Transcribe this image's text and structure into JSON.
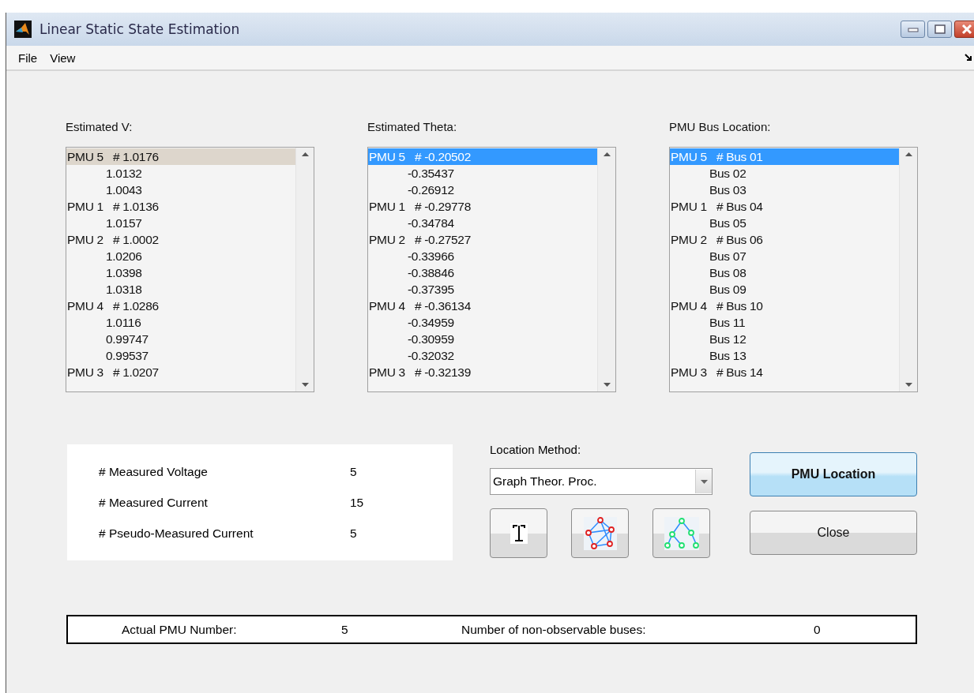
{
  "window": {
    "title": "Linear Static State Estimation"
  },
  "menu": [
    {
      "label": "File"
    },
    {
      "label": "View"
    }
  ],
  "lists": [
    {
      "label": "Estimated V:",
      "focused": false,
      "items": [
        {
          "kind": "head",
          "text": "PMU 5   # 1.0176",
          "selected": true
        },
        {
          "kind": "sub",
          "text": "1.0132",
          "selected": false
        },
        {
          "kind": "sub",
          "text": "1.0043",
          "selected": false
        },
        {
          "kind": "head",
          "text": "PMU 1   # 1.0136",
          "selected": false
        },
        {
          "kind": "sub",
          "text": "1.0157",
          "selected": false
        },
        {
          "kind": "head",
          "text": "PMU 2   # 1.0002",
          "selected": false
        },
        {
          "kind": "sub",
          "text": "1.0206",
          "selected": false
        },
        {
          "kind": "sub",
          "text": "1.0398",
          "selected": false
        },
        {
          "kind": "sub",
          "text": "1.0318",
          "selected": false
        },
        {
          "kind": "head",
          "text": "PMU 4   # 1.0286",
          "selected": false
        },
        {
          "kind": "sub",
          "text": "1.0116",
          "selected": false
        },
        {
          "kind": "sub",
          "text": "0.99747",
          "selected": false
        },
        {
          "kind": "sub",
          "text": "0.99537",
          "selected": false
        },
        {
          "kind": "head",
          "text": "PMU 3   # 1.0207",
          "selected": false
        }
      ]
    },
    {
      "label": "Estimated Theta:",
      "focused": true,
      "items": [
        {
          "kind": "head",
          "text": "PMU 5   # -0.20502",
          "selected": true
        },
        {
          "kind": "sub",
          "text": "-0.35437",
          "selected": false
        },
        {
          "kind": "sub",
          "text": "-0.26912",
          "selected": false
        },
        {
          "kind": "head",
          "text": "PMU 1   # -0.29778",
          "selected": false
        },
        {
          "kind": "sub",
          "text": "-0.34784",
          "selected": false
        },
        {
          "kind": "head",
          "text": "PMU 2   # -0.27527",
          "selected": false
        },
        {
          "kind": "sub",
          "text": "-0.33966",
          "selected": false
        },
        {
          "kind": "sub",
          "text": "-0.38846",
          "selected": false
        },
        {
          "kind": "sub",
          "text": "-0.37395",
          "selected": false
        },
        {
          "kind": "head",
          "text": "PMU 4   # -0.36134",
          "selected": false
        },
        {
          "kind": "sub",
          "text": "-0.34959",
          "selected": false
        },
        {
          "kind": "sub",
          "text": "-0.30959",
          "selected": false
        },
        {
          "kind": "sub",
          "text": "-0.32032",
          "selected": false
        },
        {
          "kind": "head",
          "text": "PMU 3   # -0.32139",
          "selected": false
        }
      ]
    },
    {
      "label": "PMU Bus Location:",
      "focused": true,
      "items": [
        {
          "kind": "head",
          "text": "PMU 5   # Bus 01",
          "selected": true
        },
        {
          "kind": "sub",
          "text": "Bus 02",
          "selected": false
        },
        {
          "kind": "sub",
          "text": "Bus 03",
          "selected": false
        },
        {
          "kind": "head",
          "text": "PMU 1   # Bus 04",
          "selected": false
        },
        {
          "kind": "sub",
          "text": "Bus 05",
          "selected": false
        },
        {
          "kind": "head",
          "text": "PMU 2   # Bus 06",
          "selected": false
        },
        {
          "kind": "sub",
          "text": "Bus 07",
          "selected": false
        },
        {
          "kind": "sub",
          "text": "Bus 08",
          "selected": false
        },
        {
          "kind": "sub",
          "text": "Bus 09",
          "selected": false
        },
        {
          "kind": "head",
          "text": "PMU 4   # Bus 10",
          "selected": false
        },
        {
          "kind": "sub",
          "text": "Bus 11",
          "selected": false
        },
        {
          "kind": "sub",
          "text": "Bus 12",
          "selected": false
        },
        {
          "kind": "sub",
          "text": "Bus 13",
          "selected": false
        },
        {
          "kind": "head",
          "text": "PMU 3   # Bus 14",
          "selected": false
        }
      ]
    }
  ],
  "measurements": [
    {
      "label": "# Measured Voltage",
      "value": "5"
    },
    {
      "label": "# Measured Current",
      "value": "15"
    },
    {
      "label": "# Pseudo-Measured Current",
      "value": "5"
    }
  ],
  "location_method": {
    "label": "Location Method:",
    "value": "Graph Theor. Proc."
  },
  "tool_buttons": [
    {
      "kind": "text-cursor"
    },
    {
      "kind": "graph"
    },
    {
      "kind": "tree"
    }
  ],
  "buttons": [
    {
      "label": "PMU Location",
      "default": true
    },
    {
      "label": "Close",
      "default": false
    }
  ],
  "status": [
    {
      "label": "Actual PMU Number:",
      "value": "5"
    },
    {
      "label": "Number of non-observable buses:",
      "value": "0"
    }
  ]
}
